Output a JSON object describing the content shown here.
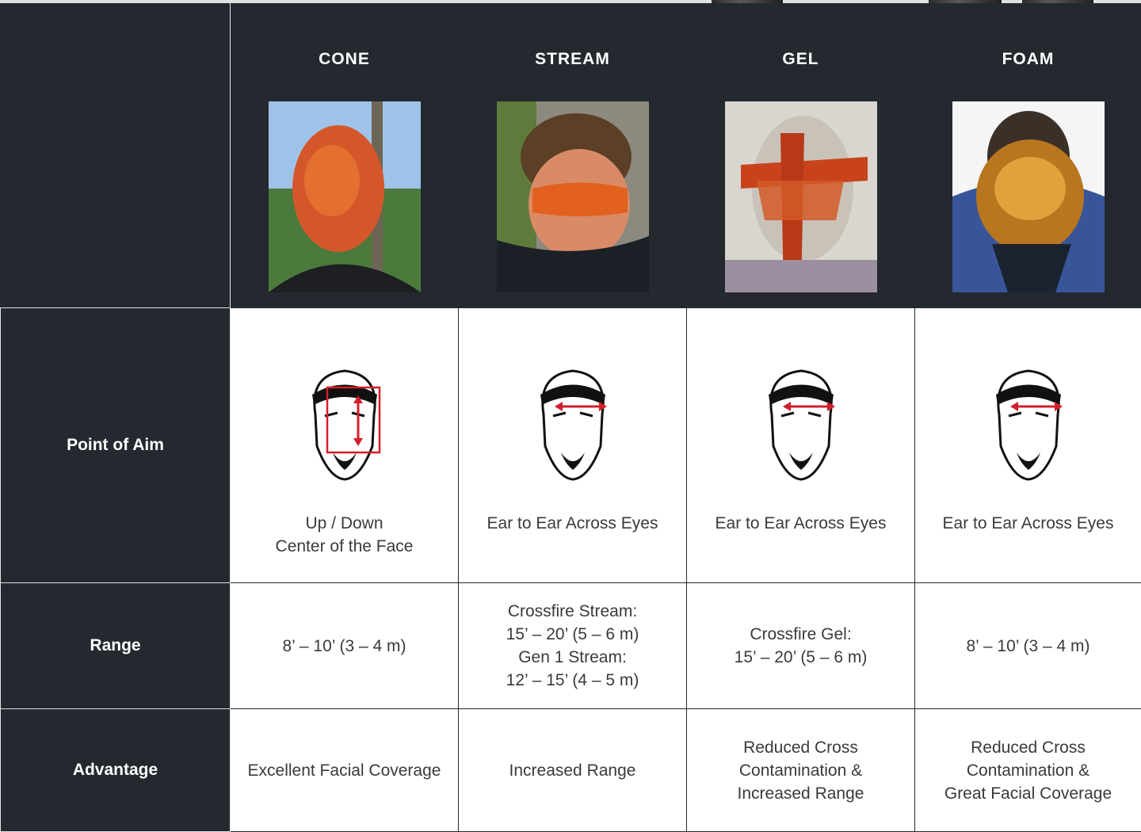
{
  "columns": [
    {
      "title": "CONE",
      "photo": "cone-photo",
      "aim": [
        "Up / Down",
        "Center of the Face"
      ],
      "aim_style": "vertical",
      "range": [
        "8’ – 10’ (3 – 4 m)"
      ],
      "advantage": [
        "Excellent Facial Coverage"
      ]
    },
    {
      "title": "STREAM",
      "photo": "stream-photo",
      "aim": [
        "Ear to Ear Across Eyes"
      ],
      "aim_style": "horizontal",
      "range": [
        "Crossfire Stream:",
        "15’ – 20’ (5 – 6 m)",
        "Gen 1 Stream:",
        "12’ – 15’ (4 – 5 m)"
      ],
      "advantage": [
        "Increased Range"
      ]
    },
    {
      "title": "GEL",
      "photo": "gel-photo",
      "aim": [
        "Ear to Ear Across Eyes"
      ],
      "aim_style": "horizontal",
      "range": [
        "Crossfire Gel:",
        "15’ – 20’ (5 – 6 m)"
      ],
      "advantage": [
        "Reduced Cross",
        "Contamination &",
        "Increased Range"
      ]
    },
    {
      "title": "FOAM",
      "photo": "foam-photo",
      "aim": [
        "Ear to Ear Across Eyes"
      ],
      "aim_style": "horizontal",
      "range": [
        "8’ – 10’ (3 – 4 m)"
      ],
      "advantage": [
        "Reduced Cross",
        "Contamination &",
        "Great Facial Coverage"
      ]
    }
  ],
  "rows": {
    "aim": "Point of Aim",
    "range": "Range",
    "advantage": "Advantage"
  },
  "colors": {
    "dark": "#23292f",
    "aim_red": "#d21e2b",
    "cone_bg": "#4b7a3c",
    "stream_bg": "#1d2228",
    "gel_bg": "#d8d6cf",
    "foam_bg": "#f5f5f5"
  },
  "icons": [
    "face-outline-icon",
    "aim-arrow-icon"
  ]
}
